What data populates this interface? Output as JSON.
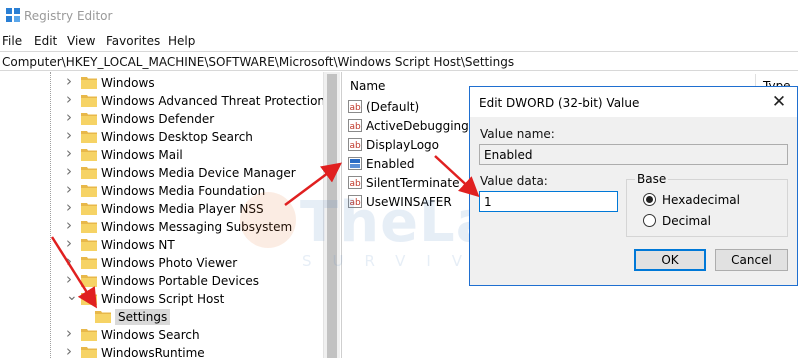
{
  "window": {
    "title": "Registry Editor"
  },
  "menu": [
    "File",
    "Edit",
    "View",
    "Favorites",
    "Help"
  ],
  "address": "Computer\\HKEY_LOCAL_MACHINE\\SOFTWARE\\Microsoft\\Windows Script Host\\Settings",
  "tree": {
    "items": [
      "Windows",
      "Windows Advanced Threat Protection",
      "Windows Defender",
      "Windows Desktop Search",
      "Windows Mail",
      "Windows Media Device Manager",
      "Windows Media Foundation",
      "Windows Media Player NSS",
      "Windows Messaging Subsystem",
      "Windows NT",
      "Windows Photo Viewer",
      "Windows Portable Devices",
      "Windows Script Host",
      "Settings",
      "Windows Search",
      "WindowsRuntime"
    ],
    "expanded_item": "Windows Script Host",
    "selected_item": "Settings"
  },
  "values_pane": {
    "columns": {
      "name": "Name",
      "type": "Type"
    },
    "rows": [
      {
        "name": "(Default)",
        "icon": "string-value-icon"
      },
      {
        "name": "ActiveDebugging",
        "icon": "string-value-icon"
      },
      {
        "name": "DisplayLogo",
        "icon": "string-value-icon"
      },
      {
        "name": "Enabled",
        "icon": "dword-value-icon"
      },
      {
        "name": "SilentTerminate",
        "icon": "string-value-icon"
      },
      {
        "name": "UseWINSAFER",
        "icon": "string-value-icon"
      }
    ]
  },
  "dialog": {
    "title": "Edit DWORD (32-bit) Value",
    "value_name_label": "Value name:",
    "value_name": "Enabled",
    "value_data_label": "Value data:",
    "value_data": "1",
    "base_label": "Base",
    "base_options": [
      "Hexadecimal",
      "Decimal"
    ],
    "base_selected": "Hexadecimal",
    "ok_label": "OK",
    "cancel_label": "Cancel",
    "close_glyph": "✕"
  },
  "watermark": {
    "line1": "TheLast",
    "line2": "SURVIVORS"
  },
  "colors": {
    "annotation_arrow": "#e02020",
    "folder": "#f6d365",
    "accent": "#0078d7"
  }
}
